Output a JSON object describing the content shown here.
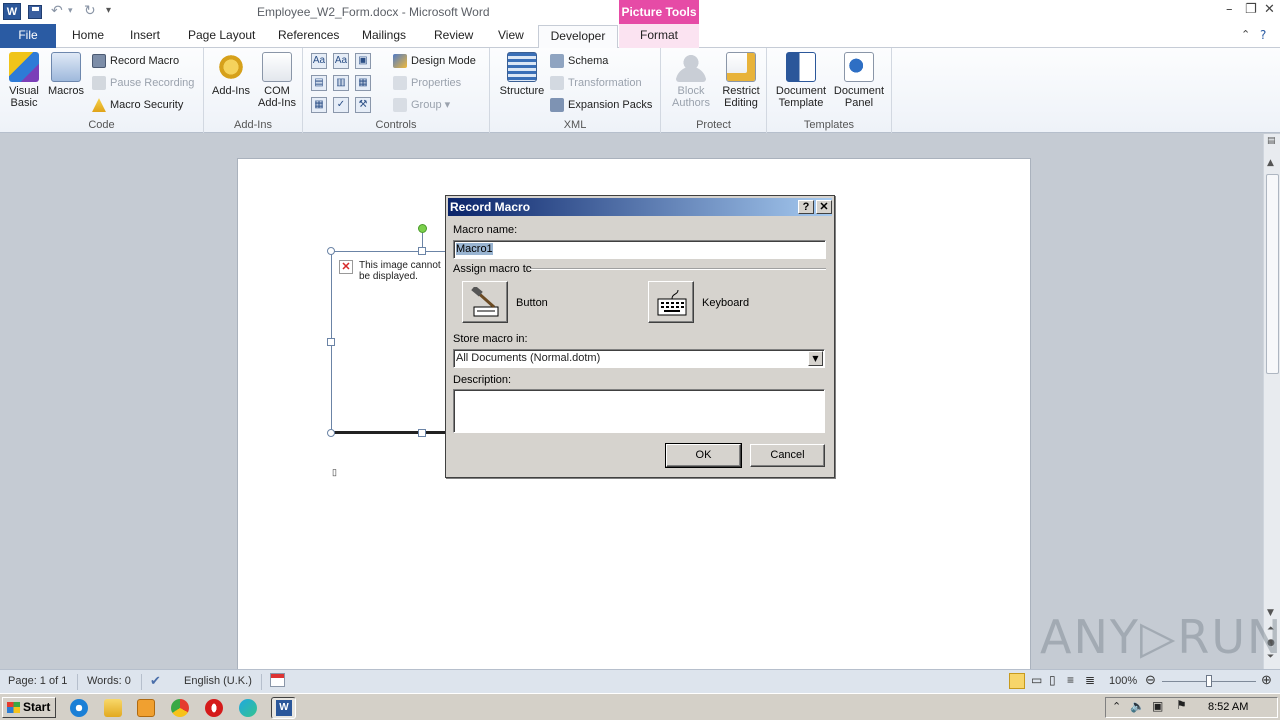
{
  "app": {
    "title": "Employee_W2_Form.docx - Microsoft Word",
    "contextual_tab_group": "Picture Tools",
    "word_icon_letter": "W"
  },
  "tabs": [
    "File",
    "Home",
    "Insert",
    "Page Layout",
    "References",
    "Mailings",
    "Review",
    "View",
    "Developer",
    "Format"
  ],
  "ribbon": {
    "code": {
      "label": "Code",
      "visual_basic": "Visual Basic",
      "macros": "Macros",
      "record_macro": "Record Macro",
      "pause_recording": "Pause Recording",
      "macro_security": "Macro Security"
    },
    "addins": {
      "label": "Add-Ins",
      "addins": "Add-Ins",
      "com_addins": "COM Add-Ins"
    },
    "controls": {
      "label": "Controls",
      "design_mode": "Design Mode",
      "properties": "Properties",
      "group": "Group"
    },
    "xml": {
      "label": "XML",
      "structure": "Structure",
      "schema": "Schema",
      "transformation": "Transformation",
      "expansion_packs": "Expansion Packs"
    },
    "protect": {
      "label": "Protect",
      "block_authors": "Block Authors",
      "restrict_editing": "Restrict Editing"
    },
    "templates": {
      "label": "Templates",
      "document_template": "Document Template",
      "document_panel": "Document Panel"
    }
  },
  "document": {
    "image_placeholder_text": "This image cannot be displayed."
  },
  "dialog": {
    "title": "Record Macro",
    "help_label": "?",
    "close_label": "✕",
    "macro_name_label": "Macro name:",
    "macro_name_value": "Macro1",
    "assign_label": "Assign macro to",
    "button_label": "Button",
    "keyboard_label": "Keyboard",
    "store_label": "Store macro in:",
    "store_value": "All Documents (Normal.dotm)",
    "description_label": "Description:",
    "description_value": "",
    "ok_label": "OK",
    "cancel_label": "Cancel"
  },
  "statusbar": {
    "page": "Page: 1 of 1",
    "words": "Words: 0",
    "language": "English (U.K.)",
    "zoom": "100%"
  },
  "taskbar": {
    "start_label": "Start",
    "clock": "8:52 AM"
  },
  "watermark": "ANY▷RUN",
  "colors": {
    "file_tab": "#2a5ba3",
    "picture_tools": "#e64ba6",
    "dialog_title_start": "#0a246a",
    "dialog_title_end": "#a6caf0"
  }
}
